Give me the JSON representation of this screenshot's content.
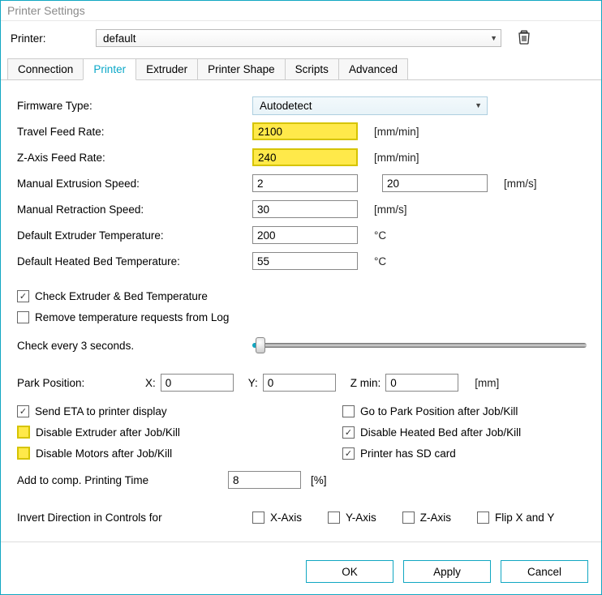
{
  "title": "Printer Settings",
  "printer_label": "Printer:",
  "printer_value": "default",
  "tabs": [
    "Connection",
    "Printer",
    "Extruder",
    "Printer Shape",
    "Scripts",
    "Advanced"
  ],
  "active_tab": 1,
  "form": {
    "firmware_label": "Firmware Type:",
    "firmware_value": "Autodetect",
    "travel_label": "Travel Feed Rate:",
    "travel_value": "2100",
    "travel_unit": "[mm/min]",
    "zfeed_label": "Z-Axis Feed Rate:",
    "zfeed_value": "240",
    "zfeed_unit": "[mm/min]",
    "extspeed_label": "Manual Extrusion Speed:",
    "extspeed_v1": "2",
    "extspeed_v2": "20",
    "extspeed_unit": "[mm/s]",
    "retr_label": "Manual Retraction Speed:",
    "retr_value": "30",
    "retr_unit": "[mm/s]",
    "exttemp_label": "Default Extruder Temperature:",
    "exttemp_value": "200",
    "exttemp_unit": "°C",
    "bedtemp_label": "Default Heated Bed Temperature:",
    "bedtemp_value": "55",
    "bedtemp_unit": "°C"
  },
  "checks": {
    "chk_temp_label": "Check Extruder & Bed Temperature",
    "chk_temp": true,
    "remove_log_label": "Remove temperature requests from Log",
    "remove_log": false,
    "check_every": "Check every 3 seconds."
  },
  "park": {
    "label": "Park Position:",
    "x_label": "X:",
    "x": "0",
    "y_label": "Y:",
    "y": "0",
    "zmin_label": "Z min:",
    "zmin": "0",
    "unit": "[mm]"
  },
  "opts": {
    "send_eta_label": "Send ETA to printer display",
    "send_eta": true,
    "gotopark_label": "Go to Park Position after Job/Kill",
    "gotopark": false,
    "disable_ext_label": "Disable Extruder after Job/Kill",
    "disable_ext": false,
    "disable_bed_label": "Disable Heated Bed after Job/Kill",
    "disable_bed": true,
    "disable_mot_label": "Disable Motors after Job/Kill",
    "disable_mot": false,
    "has_sd_label": "Printer has SD card",
    "has_sd": true
  },
  "addcomp": {
    "label": "Add to comp. Printing Time",
    "value": "8",
    "unit": "[%]"
  },
  "invert": {
    "label": "Invert Direction in Controls for",
    "x_label": "X-Axis",
    "x": false,
    "y_label": "Y-Axis",
    "y": false,
    "z_label": "Z-Axis",
    "z": false,
    "flip_label": "Flip X and Y",
    "flip": false
  },
  "buttons": {
    "ok": "OK",
    "apply": "Apply",
    "cancel": "Cancel"
  }
}
